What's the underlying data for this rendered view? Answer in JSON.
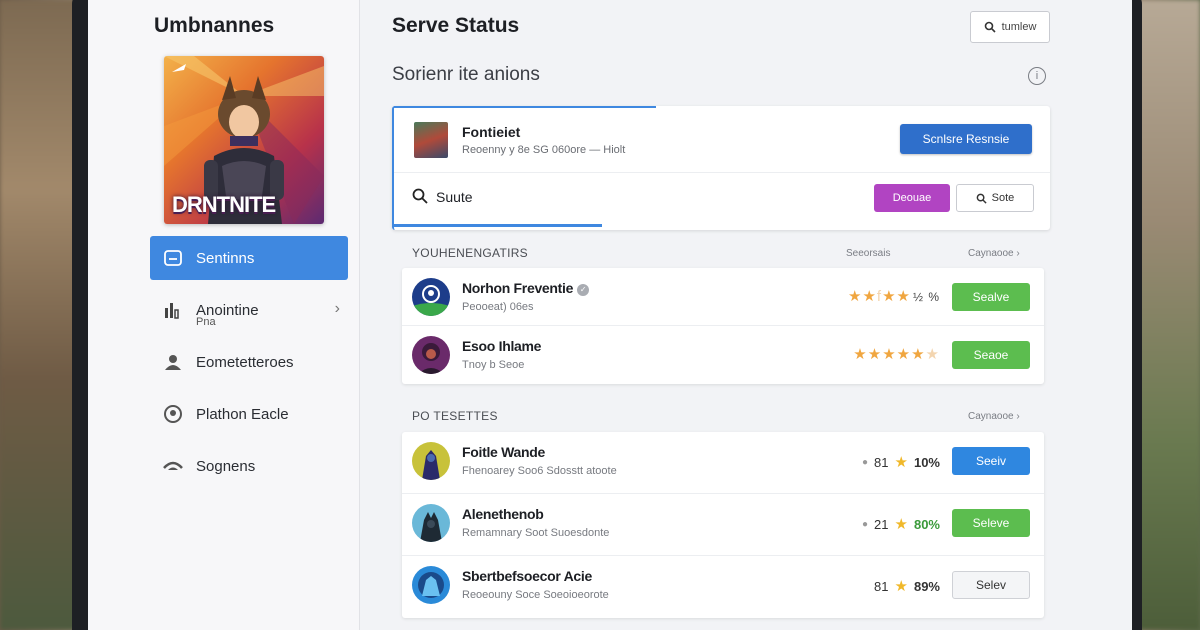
{
  "sidebar": {
    "app_title": "Umbnannes",
    "cover_label": "DRNTNITE",
    "items": [
      {
        "label": "Sentinns",
        "icon": "window-icon"
      },
      {
        "label": "Anointine",
        "sublabel": "Pna",
        "icon": "bar-chart-icon"
      },
      {
        "label": "Eometetteroes",
        "icon": "user-icon"
      },
      {
        "label": "Plathon Eacle",
        "icon": "smile-icon"
      },
      {
        "label": "Sognens",
        "icon": "signal-icon"
      }
    ]
  },
  "header": {
    "title": "Serve Status",
    "search_label": "tumlew",
    "subtitle": "Sorienr ite anions",
    "help_icon": "info-icon"
  },
  "card": {
    "game_name": "Fontieiet",
    "game_meta": "Reoenny y 8e SG 060ore — Hiolt",
    "primary_button": "Scnlsre Resnsie",
    "search_label": "Suute",
    "purple_button": "Deouae",
    "outline_button": "Sote"
  },
  "section1": {
    "title": "YOUHENENGATIRS",
    "col1": "Seeorsais",
    "col2": "Caynaooe",
    "rows": [
      {
        "name": "Norhon Freventie",
        "verified": true,
        "meta": "Peooeat) 06es",
        "rating_text": "½ %",
        "button": "Sealve",
        "button_style": "green"
      },
      {
        "name": "Esoo Ihlame",
        "verified": false,
        "meta": "Tnoy b Seoe",
        "rating_text": "",
        "button": "Seaoe",
        "button_style": "green"
      }
    ]
  },
  "section2": {
    "title": "PO TESETTES",
    "col1": "Caynaooe",
    "rows": [
      {
        "name": "Foitle Wande",
        "meta": "Fhenoarey Soo6 Sdosstt atoote",
        "num": "81",
        "pct": "10%",
        "button": "Seeiv",
        "button_style": "blue"
      },
      {
        "name": "Alenethenob",
        "meta": "Remamnary Soot Suoesdonte",
        "num": "21",
        "pct": "80%",
        "button": "Seleve",
        "button_style": "green"
      },
      {
        "name": "Sbertbefsoecor Acie",
        "meta": "Reoeouny Soce Soeoioeorote",
        "num": "81",
        "pct": "89%",
        "button": "Selev",
        "button_style": "gray"
      }
    ]
  },
  "colors": {
    "accent": "#3f88e0",
    "primary_button": "#2f6fcb",
    "purple": "#b144c2",
    "green": "#5cbd4f",
    "star": "#f0a640"
  }
}
